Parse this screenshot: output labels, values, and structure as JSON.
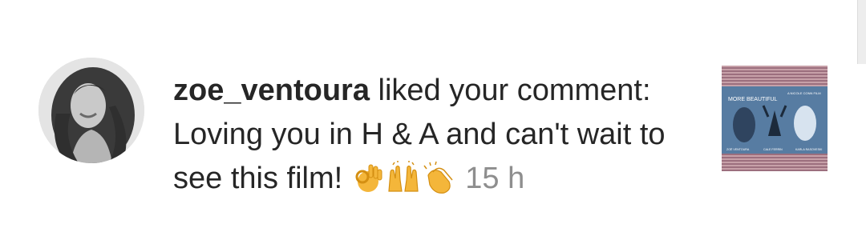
{
  "notification": {
    "username": "zoe_ventoura",
    "action_text": "liked your comment:",
    "comment_text": "Loving you in H & A and can't wait to see this film!",
    "emojis": [
      "ok-hand-emoji",
      "raising-hands-emoji",
      "clapping-hands-emoji"
    ],
    "timestamp": "15 h"
  },
  "post_thumbnail": {
    "title": "MORE BEAUTIFUL",
    "credit": "A NICOLE CONN FILM",
    "cast": [
      "ZOË VENTOURA",
      "CALE FERRIN",
      "KARLA RASOVESKI"
    ],
    "colors": {
      "stripe_light": "#c7a0a8",
      "stripe_dark": "#9c6f7e",
      "poster": "#4a6f96"
    }
  }
}
